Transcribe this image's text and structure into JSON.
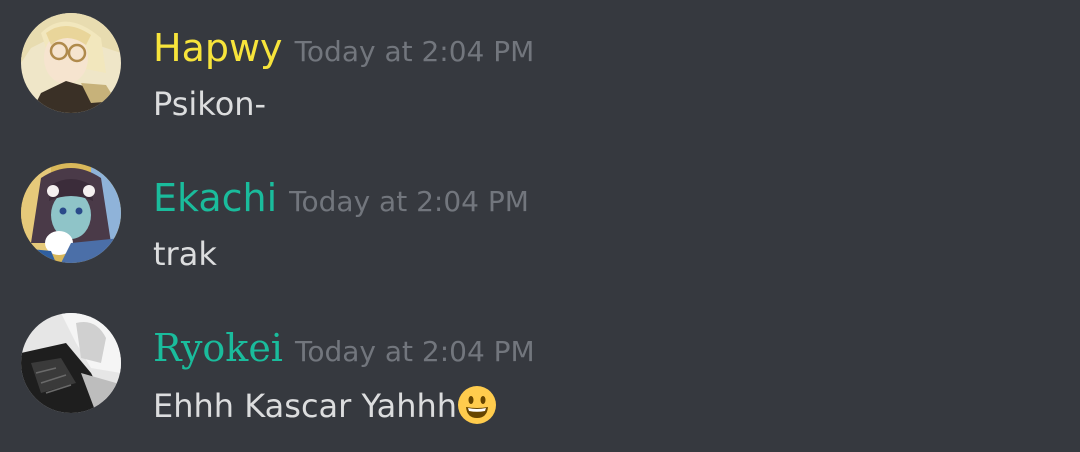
{
  "messages": [
    {
      "username": "Hapwy",
      "username_color": "#f7e43b",
      "timestamp": "Today at 2:04 PM",
      "content": "Psikon-",
      "avatar_icon": "anime-avatar-blonde-glasses"
    },
    {
      "username": "Ekachi",
      "username_color": "#1abc9c",
      "timestamp": "Today at 2:04 PM",
      "content": "trak",
      "avatar_icon": "anime-avatar-dark-hair"
    },
    {
      "username": "Ryokei",
      "username_color": "#1abc9c",
      "timestamp": "Today at 2:04 PM",
      "content": "Ehhh Kascar Yahhh",
      "content_emoji": "grinning-face-emoji",
      "avatar_icon": "sketch-avatar-monochrome"
    }
  ],
  "colors": {
    "background": "#36393f",
    "text": "#dcddde",
    "timestamp": "#72767d"
  }
}
